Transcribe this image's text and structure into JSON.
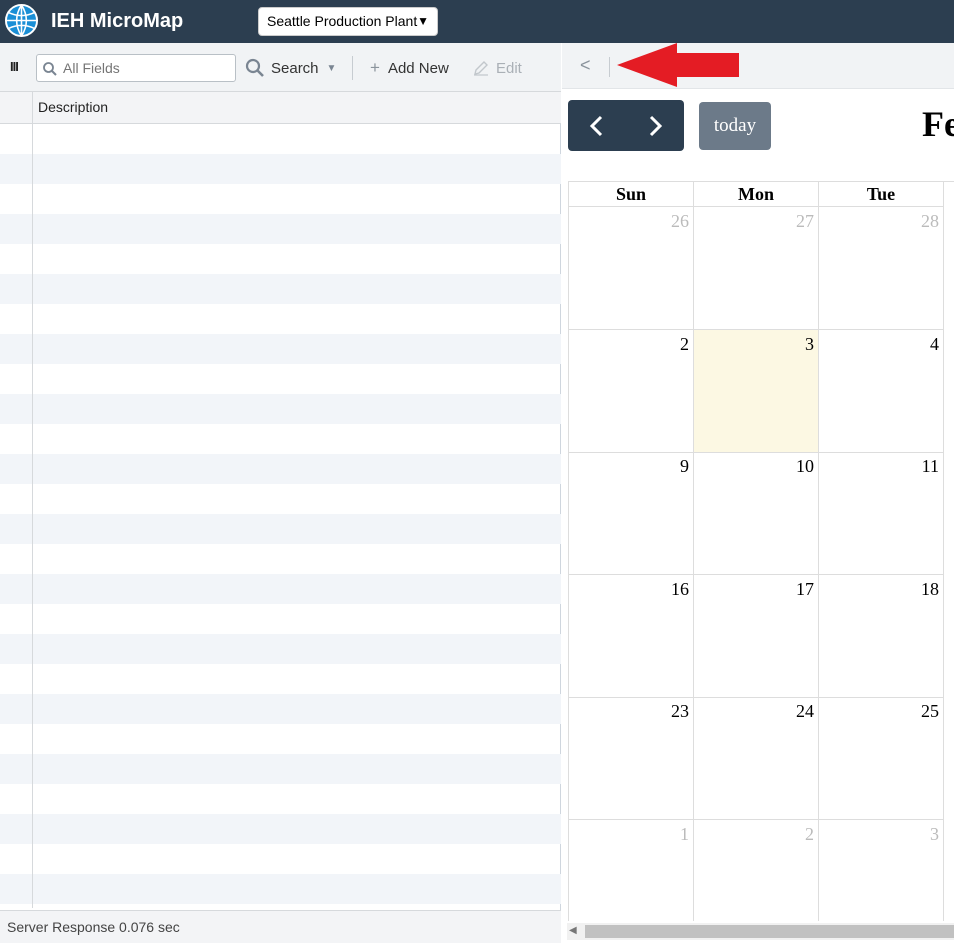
{
  "app": {
    "title": "IEH MicroMap",
    "site": "Seattle Production Plant"
  },
  "toolbar": {
    "search_placeholder": "All Fields",
    "search_label": "Search",
    "add_new_label": "Add New",
    "edit_label": "Edit"
  },
  "grid": {
    "columns": [
      "Description"
    ],
    "rows": []
  },
  "status": {
    "text": "Server Response 0.076 sec"
  },
  "calendar": {
    "today_label": "today",
    "title": "Fe",
    "weekdays": [
      "Sun",
      "Mon",
      "Tue"
    ],
    "weeks": [
      [
        "26",
        "27",
        "28"
      ],
      [
        "2",
        "3",
        "4"
      ],
      [
        "9",
        "10",
        "11"
      ],
      [
        "16",
        "17",
        "18"
      ],
      [
        "23",
        "24",
        "25"
      ],
      [
        "1",
        "2",
        "3"
      ]
    ],
    "today_cell": "3"
  },
  "colors": {
    "topbar": "#2c3e50",
    "arrow": "#e41c24",
    "today_bg": "#fcf8e3"
  },
  "icons": [
    "globe-logo-icon",
    "columns-icon",
    "search-icon",
    "plus-icon",
    "pencil-icon",
    "chevron-left-icon",
    "chevron-right-icon",
    "red-arrow-icon"
  ]
}
